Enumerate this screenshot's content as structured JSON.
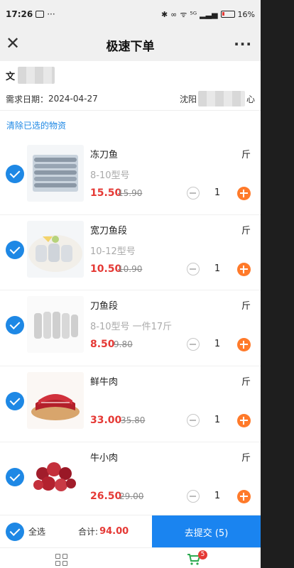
{
  "status_bar": {
    "time": "17:26",
    "notif_icon_text": "···",
    "network": "⁵ᴳ",
    "battery": "16%"
  },
  "nav": {
    "title": "极速下单",
    "more": "···"
  },
  "info": {
    "name_prefix": "文",
    "date_label": "需求日期：",
    "date": "2024-04-27",
    "city_prefix": "沈阳",
    "city_suffix": "心"
  },
  "clear_label": "清除已选的物资",
  "items": [
    {
      "name": "冻刀鱼",
      "unit": "斤",
      "spec": "8-10型号",
      "price": "15.50",
      "old_price": "15.90",
      "qty": "1"
    },
    {
      "name": "宽刀鱼段",
      "unit": "斤",
      "spec": "10-12型号",
      "price": "10.50",
      "old_price": "10.90",
      "qty": "1"
    },
    {
      "name": "刀鱼段",
      "unit": "斤",
      "spec": "8-10型号 一件17斤",
      "price": "8.50",
      "old_price": "9.80",
      "qty": "1"
    },
    {
      "name": "鲜牛肉",
      "unit": "斤",
      "spec": "",
      "price": "33.00",
      "old_price": "35.80",
      "qty": "1"
    },
    {
      "name": "牛小肉",
      "unit": "斤",
      "spec": "",
      "price": "26.50",
      "old_price": "29.00",
      "qty": "1"
    }
  ],
  "bottom": {
    "select_all": "全选",
    "total_label": "合计:",
    "total_value": "94.00",
    "submit_label": "去提交 (5)"
  },
  "tabbar": {
    "cart_badge": "5"
  },
  "colors": {
    "accent_blue": "#1a84f0",
    "price_red": "#e53935",
    "plus_orange": "#ff7a2a"
  }
}
